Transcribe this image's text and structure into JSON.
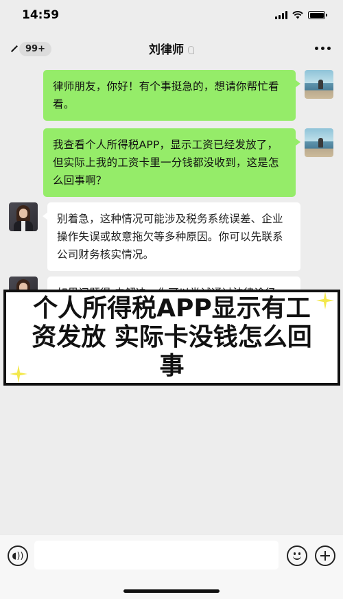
{
  "status_bar": {
    "time": "14:59",
    "icons": [
      "signal-icon",
      "wifi-icon",
      "battery-icon"
    ]
  },
  "nav": {
    "unread_count": "99+",
    "title": "刘律师",
    "icons": [
      "back-chevron-icon",
      "ear-icon",
      "more-icon"
    ]
  },
  "messages": [
    {
      "sender": "user",
      "text": "律师朋友，你好！有个事挺急的，想请你帮忙看看。"
    },
    {
      "sender": "user",
      "text": "我查看个人所得税APP，显示工资已经发放了，但实际上我的工资卡里一分钱都没收到，这是怎么回事啊？"
    },
    {
      "sender": "lawyer",
      "text": "别着急，这种情况可能涉及税务系统误差、企业操作失误或故意拖欠等多种原因。你可以先联系公司财务核实情况。"
    },
    {
      "sender": "lawyer",
      "text": "如果问题得 未解决，你可以尝试通过法律途径"
    }
  ],
  "overlay": {
    "caption": "个人所得税APP显示有工资发放 实际卡没钱怎么回事"
  },
  "input_bar": {
    "icons": [
      "voice-icon",
      "emoji-icon",
      "plus-icon"
    ],
    "placeholder": ""
  },
  "colors": {
    "background": "#ededed",
    "user_bubble": "#95ec69",
    "lawyer_bubble": "#ffffff",
    "sparkle": "#f3e84c"
  }
}
